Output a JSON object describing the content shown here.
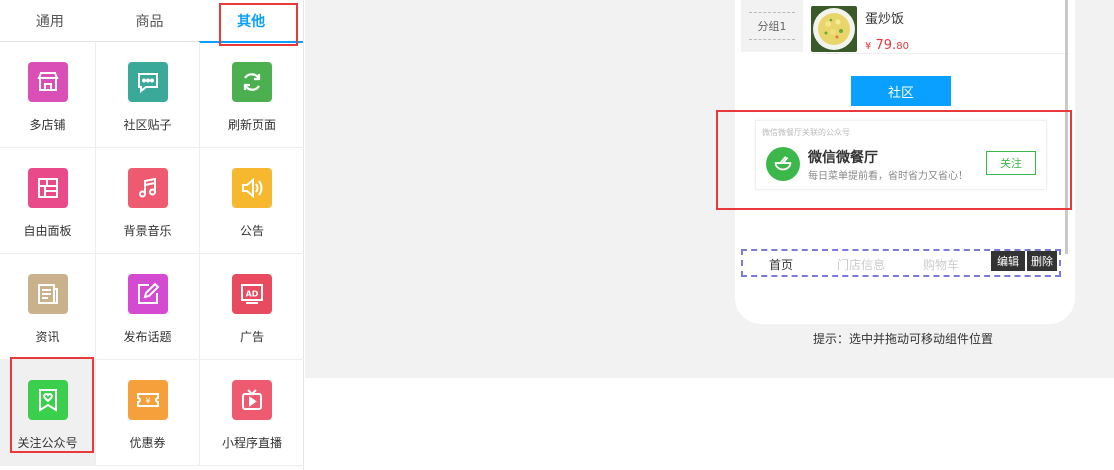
{
  "tabs": [
    {
      "label": "通用",
      "active": false
    },
    {
      "label": "商品",
      "active": false
    },
    {
      "label": "其他",
      "active": true
    }
  ],
  "components": [
    {
      "label": "多店铺",
      "icon": "multi-store-icon",
      "color": "#d94fb5"
    },
    {
      "label": "社区贴子",
      "icon": "community-post-icon",
      "color": "#3aa999"
    },
    {
      "label": "刷新页面",
      "icon": "refresh-icon",
      "color": "#4caf50"
    },
    {
      "label": "自由面板",
      "icon": "free-panel-icon",
      "color": "#e84a8a"
    },
    {
      "label": "背景音乐",
      "icon": "music-icon",
      "color": "#ee5a6f"
    },
    {
      "label": "公告",
      "icon": "announcement-icon",
      "color": "#f5b82e"
    },
    {
      "label": "资讯",
      "icon": "news-icon",
      "color": "#c9b18c"
    },
    {
      "label": "发布话题",
      "icon": "publish-topic-icon",
      "color": "#d44ad0"
    },
    {
      "label": "广告",
      "icon": "ad-icon",
      "color": "#e84a5f"
    },
    {
      "label": "关注公众号",
      "icon": "follow-official-account-icon",
      "color": "#3ccf4e"
    },
    {
      "label": "优惠券",
      "icon": "coupon-icon",
      "color": "#f5a03b"
    },
    {
      "label": "小程序直播",
      "icon": "mini-program-live-icon",
      "color": "#ee5a6f"
    }
  ],
  "preview": {
    "product": {
      "group": "分组1",
      "name": "蛋炒饭",
      "price_symbol": "¥",
      "price_main": "79.",
      "price_cents": "80"
    },
    "community_button": "社区",
    "official_account": {
      "caption": "微信微餐厅关联的公众号",
      "name": "微信微餐厅",
      "description": "每日菜单提前看，省时省力又省心！",
      "follow_label": "关注"
    },
    "nav": {
      "items": [
        "首页",
        "门店信息",
        "购物车"
      ],
      "edit_label": "编辑",
      "delete_label": "删除"
    }
  },
  "hint": "提示：选中并拖动可移动组件位置"
}
